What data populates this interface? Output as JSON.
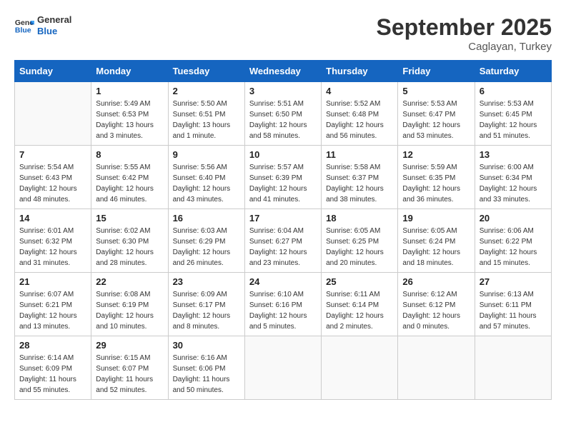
{
  "header": {
    "logo_line1": "General",
    "logo_line2": "Blue",
    "month_title": "September 2025",
    "location": "Caglayan, Turkey"
  },
  "weekdays": [
    "Sunday",
    "Monday",
    "Tuesday",
    "Wednesday",
    "Thursday",
    "Friday",
    "Saturday"
  ],
  "weeks": [
    [
      {
        "day": "",
        "info": ""
      },
      {
        "day": "1",
        "info": "Sunrise: 5:49 AM\nSunset: 6:53 PM\nDaylight: 13 hours\nand 3 minutes."
      },
      {
        "day": "2",
        "info": "Sunrise: 5:50 AM\nSunset: 6:51 PM\nDaylight: 13 hours\nand 1 minute."
      },
      {
        "day": "3",
        "info": "Sunrise: 5:51 AM\nSunset: 6:50 PM\nDaylight: 12 hours\nand 58 minutes."
      },
      {
        "day": "4",
        "info": "Sunrise: 5:52 AM\nSunset: 6:48 PM\nDaylight: 12 hours\nand 56 minutes."
      },
      {
        "day": "5",
        "info": "Sunrise: 5:53 AM\nSunset: 6:47 PM\nDaylight: 12 hours\nand 53 minutes."
      },
      {
        "day": "6",
        "info": "Sunrise: 5:53 AM\nSunset: 6:45 PM\nDaylight: 12 hours\nand 51 minutes."
      }
    ],
    [
      {
        "day": "7",
        "info": "Sunrise: 5:54 AM\nSunset: 6:43 PM\nDaylight: 12 hours\nand 48 minutes."
      },
      {
        "day": "8",
        "info": "Sunrise: 5:55 AM\nSunset: 6:42 PM\nDaylight: 12 hours\nand 46 minutes."
      },
      {
        "day": "9",
        "info": "Sunrise: 5:56 AM\nSunset: 6:40 PM\nDaylight: 12 hours\nand 43 minutes."
      },
      {
        "day": "10",
        "info": "Sunrise: 5:57 AM\nSunset: 6:39 PM\nDaylight: 12 hours\nand 41 minutes."
      },
      {
        "day": "11",
        "info": "Sunrise: 5:58 AM\nSunset: 6:37 PM\nDaylight: 12 hours\nand 38 minutes."
      },
      {
        "day": "12",
        "info": "Sunrise: 5:59 AM\nSunset: 6:35 PM\nDaylight: 12 hours\nand 36 minutes."
      },
      {
        "day": "13",
        "info": "Sunrise: 6:00 AM\nSunset: 6:34 PM\nDaylight: 12 hours\nand 33 minutes."
      }
    ],
    [
      {
        "day": "14",
        "info": "Sunrise: 6:01 AM\nSunset: 6:32 PM\nDaylight: 12 hours\nand 31 minutes."
      },
      {
        "day": "15",
        "info": "Sunrise: 6:02 AM\nSunset: 6:30 PM\nDaylight: 12 hours\nand 28 minutes."
      },
      {
        "day": "16",
        "info": "Sunrise: 6:03 AM\nSunset: 6:29 PM\nDaylight: 12 hours\nand 26 minutes."
      },
      {
        "day": "17",
        "info": "Sunrise: 6:04 AM\nSunset: 6:27 PM\nDaylight: 12 hours\nand 23 minutes."
      },
      {
        "day": "18",
        "info": "Sunrise: 6:05 AM\nSunset: 6:25 PM\nDaylight: 12 hours\nand 20 minutes."
      },
      {
        "day": "19",
        "info": "Sunrise: 6:05 AM\nSunset: 6:24 PM\nDaylight: 12 hours\nand 18 minutes."
      },
      {
        "day": "20",
        "info": "Sunrise: 6:06 AM\nSunset: 6:22 PM\nDaylight: 12 hours\nand 15 minutes."
      }
    ],
    [
      {
        "day": "21",
        "info": "Sunrise: 6:07 AM\nSunset: 6:21 PM\nDaylight: 12 hours\nand 13 minutes."
      },
      {
        "day": "22",
        "info": "Sunrise: 6:08 AM\nSunset: 6:19 PM\nDaylight: 12 hours\nand 10 minutes."
      },
      {
        "day": "23",
        "info": "Sunrise: 6:09 AM\nSunset: 6:17 PM\nDaylight: 12 hours\nand 8 minutes."
      },
      {
        "day": "24",
        "info": "Sunrise: 6:10 AM\nSunset: 6:16 PM\nDaylight: 12 hours\nand 5 minutes."
      },
      {
        "day": "25",
        "info": "Sunrise: 6:11 AM\nSunset: 6:14 PM\nDaylight: 12 hours\nand 2 minutes."
      },
      {
        "day": "26",
        "info": "Sunrise: 6:12 AM\nSunset: 6:12 PM\nDaylight: 12 hours\nand 0 minutes."
      },
      {
        "day": "27",
        "info": "Sunrise: 6:13 AM\nSunset: 6:11 PM\nDaylight: 11 hours\nand 57 minutes."
      }
    ],
    [
      {
        "day": "28",
        "info": "Sunrise: 6:14 AM\nSunset: 6:09 PM\nDaylight: 11 hours\nand 55 minutes."
      },
      {
        "day": "29",
        "info": "Sunrise: 6:15 AM\nSunset: 6:07 PM\nDaylight: 11 hours\nand 52 minutes."
      },
      {
        "day": "30",
        "info": "Sunrise: 6:16 AM\nSunset: 6:06 PM\nDaylight: 11 hours\nand 50 minutes."
      },
      {
        "day": "",
        "info": ""
      },
      {
        "day": "",
        "info": ""
      },
      {
        "day": "",
        "info": ""
      },
      {
        "day": "",
        "info": ""
      }
    ]
  ]
}
